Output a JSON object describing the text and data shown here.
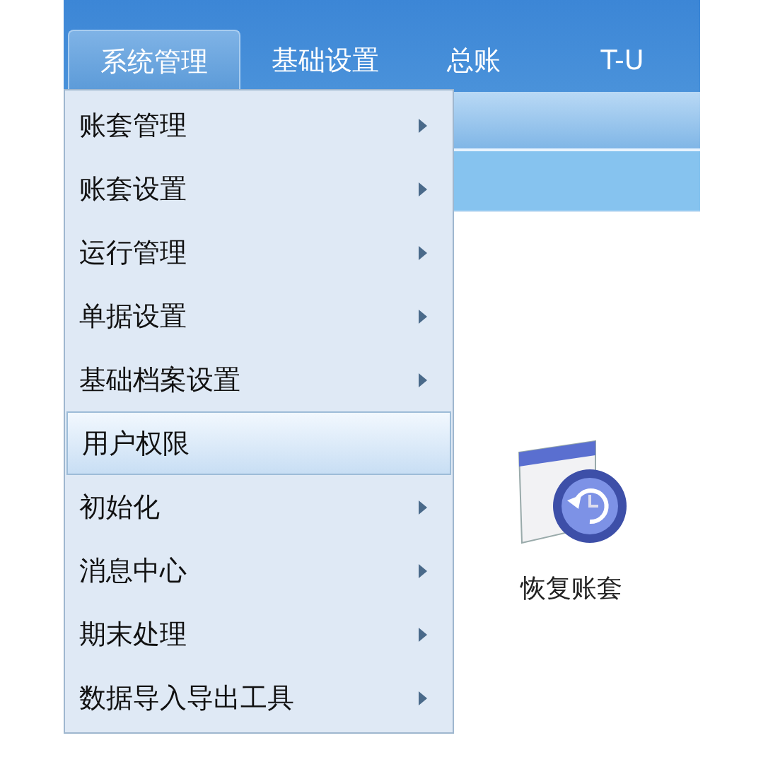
{
  "tabs": [
    {
      "label": "系统管理",
      "selected": true
    },
    {
      "label": "基础设置",
      "selected": false
    },
    {
      "label": "总账",
      "selected": false
    },
    {
      "label": "T-U",
      "selected": false
    }
  ],
  "menu": {
    "items": [
      {
        "label": "账套管理",
        "has_submenu": true,
        "selected": false
      },
      {
        "label": "账套设置",
        "has_submenu": true,
        "selected": false
      },
      {
        "label": "运行管理",
        "has_submenu": true,
        "selected": false
      },
      {
        "label": "单据设置",
        "has_submenu": true,
        "selected": false
      },
      {
        "label": "基础档案设置",
        "has_submenu": true,
        "selected": false
      },
      {
        "label": "用户权限",
        "has_submenu": false,
        "selected": true
      },
      {
        "label": "初始化",
        "has_submenu": true,
        "selected": false
      },
      {
        "label": "消息中心",
        "has_submenu": true,
        "selected": false
      },
      {
        "label": "期末处理",
        "has_submenu": true,
        "selected": false
      },
      {
        "label": "数据导入导出工具",
        "has_submenu": true,
        "selected": false
      }
    ]
  },
  "shortcuts": [
    {
      "label": "恢复账套"
    }
  ]
}
